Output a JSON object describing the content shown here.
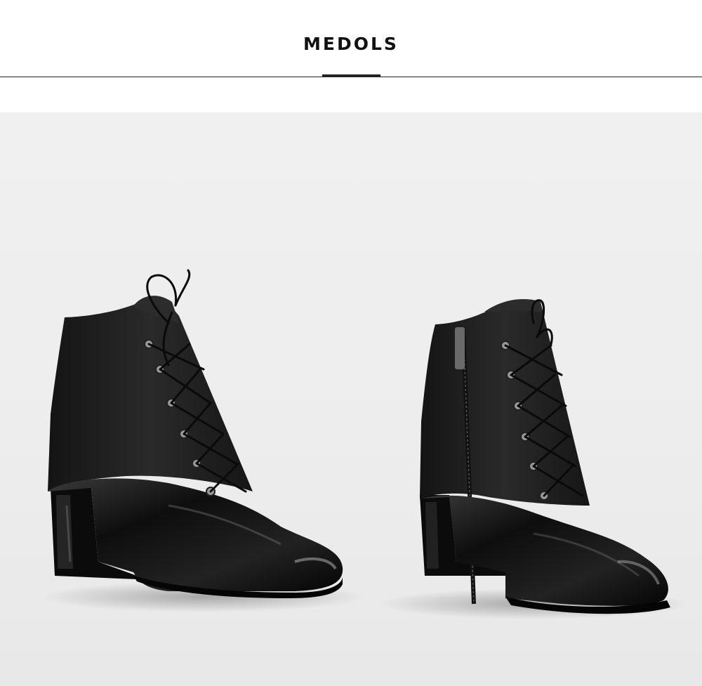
{
  "header": {
    "brand": "MEDOLS"
  },
  "photo": {
    "subject": "boots-photo",
    "colors": {
      "background": "#ececec",
      "leather": "#1c1c1c",
      "patent": "#0d0d0d",
      "eyelet": "#9a9a9a"
    }
  }
}
